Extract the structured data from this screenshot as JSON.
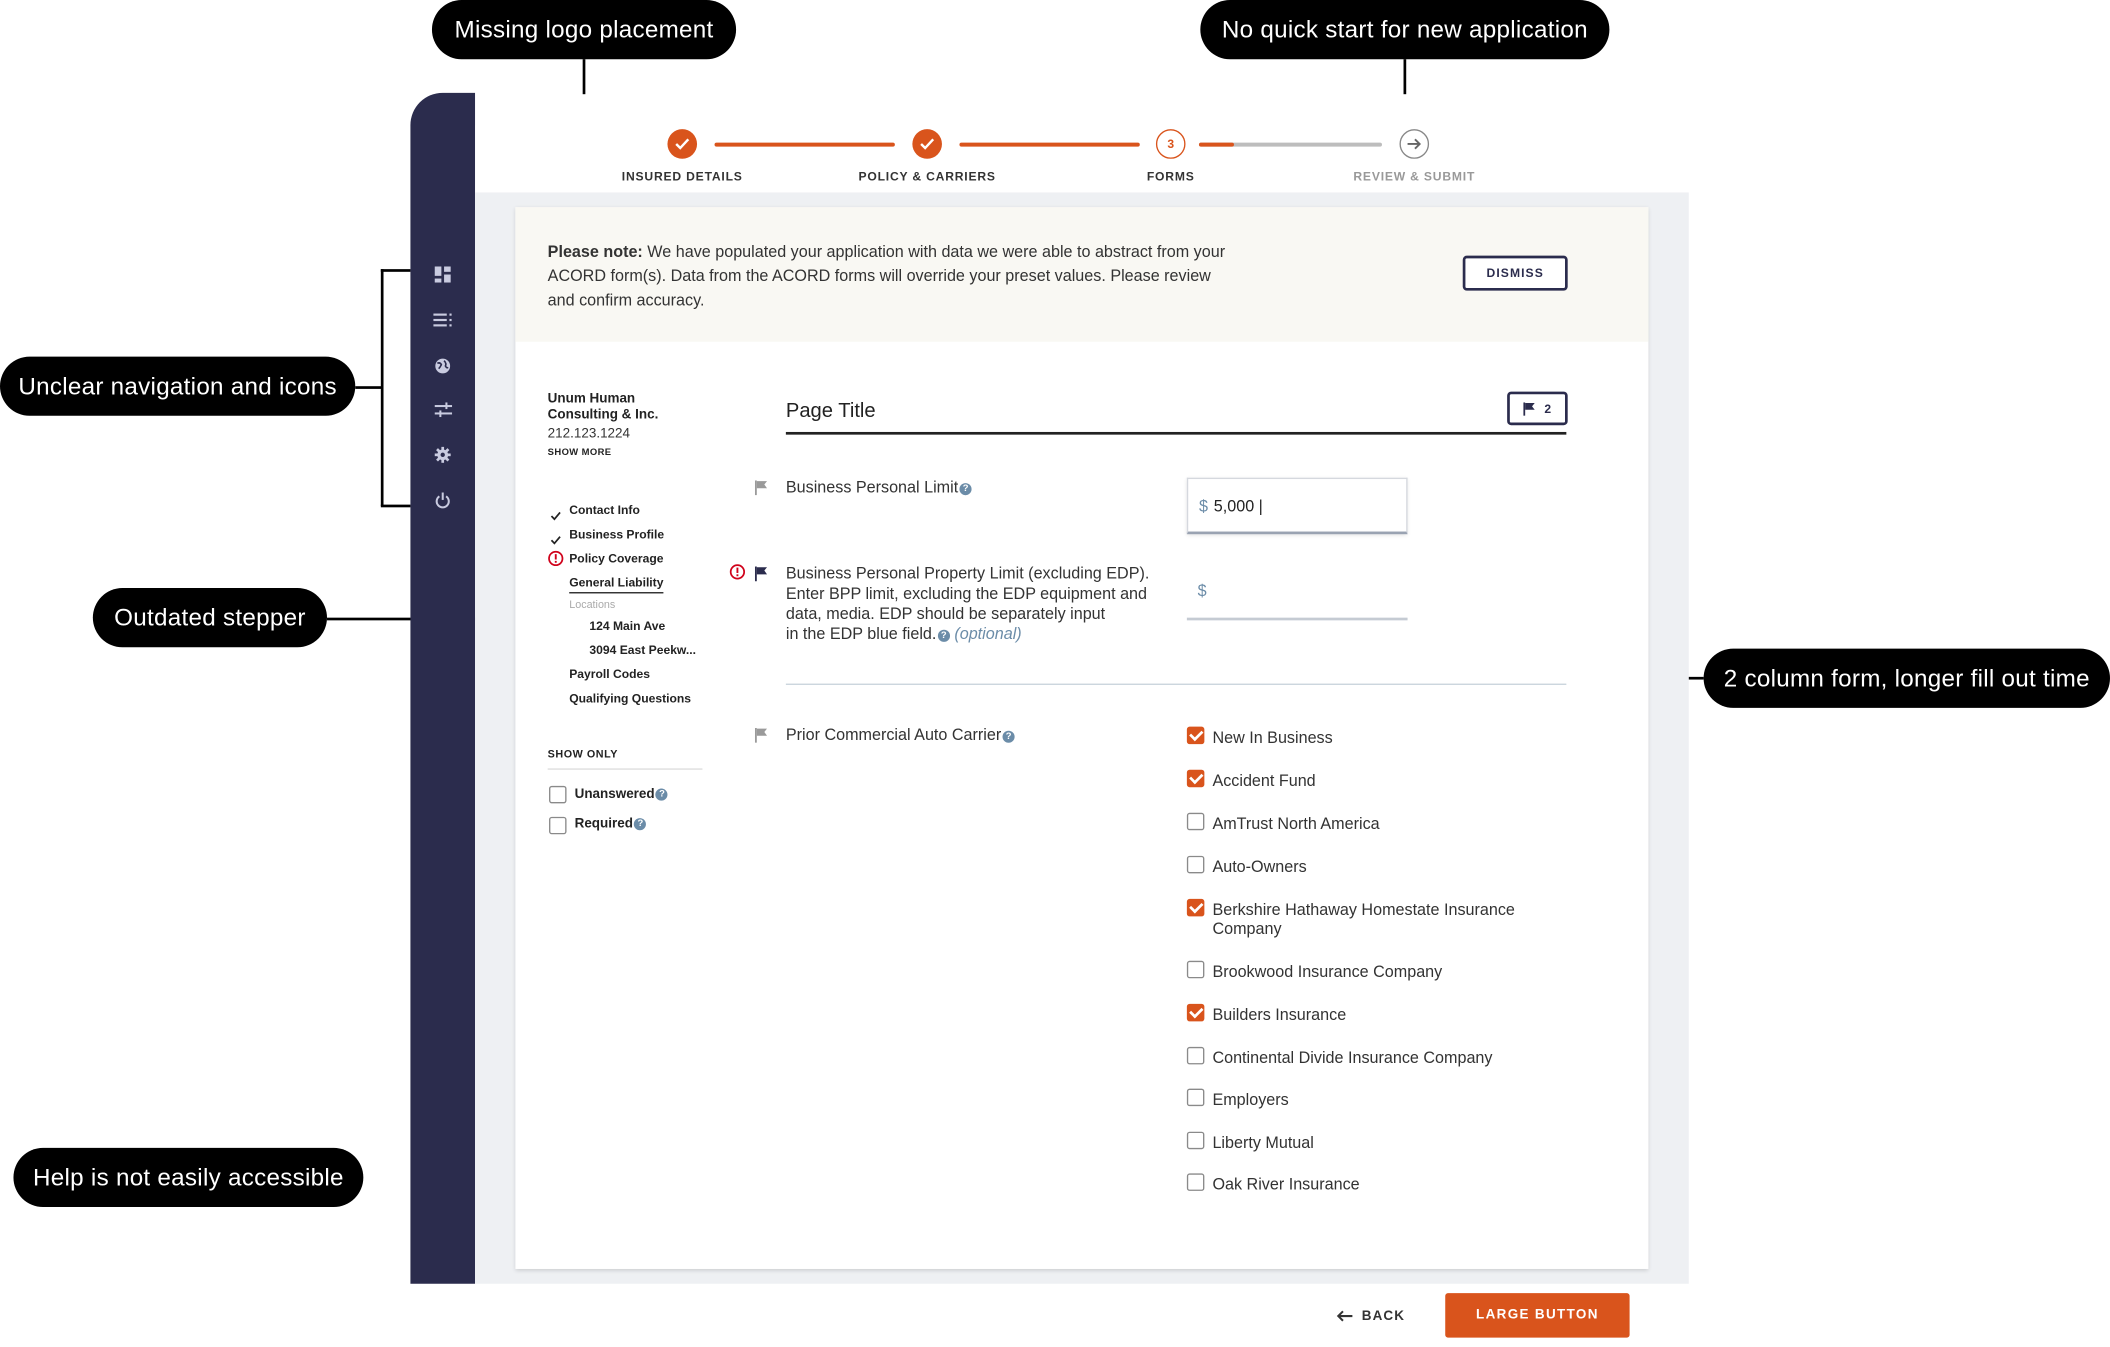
{
  "callouts": {
    "logo": "Missing logo placement",
    "quickstart": "No quick start for new application",
    "navigation": "Unclear navigation and icons",
    "stepper": "Outdated stepper",
    "form": "2 column form, longer fill out time",
    "help": "Help is not easily accessible"
  },
  "stepper": {
    "steps": [
      {
        "label": "INSURED DETAILS",
        "state": "done"
      },
      {
        "label": "POLICY & CARRIERS",
        "state": "done"
      },
      {
        "label": "FORMS",
        "state": "current",
        "number": "3"
      },
      {
        "label": "REVIEW & SUBMIT",
        "state": "upcoming"
      }
    ],
    "colors": {
      "accent": "#d9541c",
      "inactive": "#bdbdbd"
    }
  },
  "sidebar": {
    "icons": [
      "dashboard-icon",
      "list-icon",
      "globe-icon",
      "sliders-icon",
      "gear-icon",
      "power-icon"
    ],
    "color": "#2b2c4d"
  },
  "note": {
    "bold": "Please note:",
    "line1": " We have populated your application with data we were able to abstract from your",
    "line2": "ACORD form(s). Data from the ACORD forms will override your preset values.  Please review",
    "line3": "and confirm accuracy.",
    "dismiss": "DISMISS"
  },
  "company": {
    "name_line1": "Unum Human",
    "name_line2": "Consulting & Inc.",
    "phone": "212.123.1224",
    "show_more": "SHOW MORE"
  },
  "section_nav": {
    "contact": "Contact Info",
    "profile": "Business Profile",
    "coverage": "Policy Coverage",
    "general": "General Liability",
    "locations_label": "Locations",
    "loc1": "124 Main Ave",
    "loc2": "3094 East Peekw...",
    "payroll": "Payroll Codes",
    "qualifying": "Qualifying Questions"
  },
  "filters": {
    "title": "SHOW ONLY",
    "unanswered": "Unanswered",
    "required": "Required"
  },
  "form": {
    "page_title": "Page Title",
    "flag_count": "2",
    "q1_label": "Business Personal Limit",
    "q1_currency": "$",
    "q1_value": "5,000 |",
    "q2_line1": "Business Personal Property Limit (excluding EDP).",
    "q2_line2": "Enter BPP limit, excluding the EDP equipment and",
    "q2_line3": "data, media. EDP should be separately input",
    "q2_line4": "in the EDP blue field.",
    "q2_optional": "(optional)",
    "q2_currency": "$",
    "q3_label": "Prior Commercial Auto Carrier",
    "carriers": [
      {
        "label": "New In Business",
        "checked": true
      },
      {
        "label": "Accident Fund",
        "checked": true
      },
      {
        "label": "AmTrust North America",
        "checked": false
      },
      {
        "label": "Auto-Owners",
        "checked": false
      },
      {
        "label": "Berkshire Hathaway Homestate Insurance",
        "label2": "Company",
        "checked": true
      },
      {
        "label": "Brookwood Insurance Company",
        "checked": false
      },
      {
        "label": "Builders Insurance",
        "checked": true
      },
      {
        "label": "Continental Divide Insurance Company",
        "checked": false
      },
      {
        "label": "Employers",
        "checked": false
      },
      {
        "label": "Liberty Mutual",
        "checked": false
      },
      {
        "label": "Oak River Insurance",
        "checked": false
      }
    ]
  },
  "footer": {
    "back": "BACK",
    "primary": "LARGE BUTTON"
  }
}
